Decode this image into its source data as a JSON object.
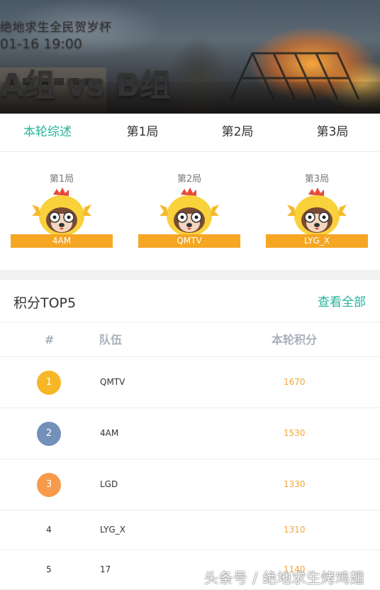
{
  "header": {
    "title": "绝地求生全民贺岁杯",
    "time": "01-16 19:00",
    "match": "A组 vs B组"
  },
  "tabs": [
    {
      "label": "本轮综述",
      "active": true
    },
    {
      "label": "第1局",
      "active": false
    },
    {
      "label": "第2局",
      "active": false
    },
    {
      "label": "第3局",
      "active": false
    }
  ],
  "rounds": [
    {
      "label": "第1局",
      "winner": "4AM",
      "icon": "chicken-mascot-icon"
    },
    {
      "label": "第2局",
      "winner": "QMTV",
      "icon": "chicken-mascot-icon"
    },
    {
      "label": "第3局",
      "winner": "LYG_X",
      "icon": "chicken-mascot-icon"
    }
  ],
  "ranking": {
    "title": "积分TOP5",
    "view_all": "查看全部",
    "columns": {
      "num": "#",
      "team": "队伍",
      "score": "本轮积分"
    },
    "rows": [
      {
        "rank": "1",
        "team": "QMTV",
        "score": "1670",
        "badge_color": "#f6b726"
      },
      {
        "rank": "2",
        "team": "4AM",
        "score": "1530",
        "badge_color": "#7290b8"
      },
      {
        "rank": "3",
        "team": "LGD",
        "score": "1330",
        "badge_color": "#f79a4b"
      },
      {
        "rank": "4",
        "team": "LYG_X",
        "score": "1310",
        "badge_color": ""
      },
      {
        "rank": "5",
        "team": "17",
        "score": "1140",
        "badge_color": ""
      }
    ]
  },
  "watermark": "头条号 / 绝地求生烤鸡翅",
  "colors": {
    "accent": "#27b39b",
    "winner_bar": "#f5a623",
    "score_text": "#f0a63c"
  }
}
